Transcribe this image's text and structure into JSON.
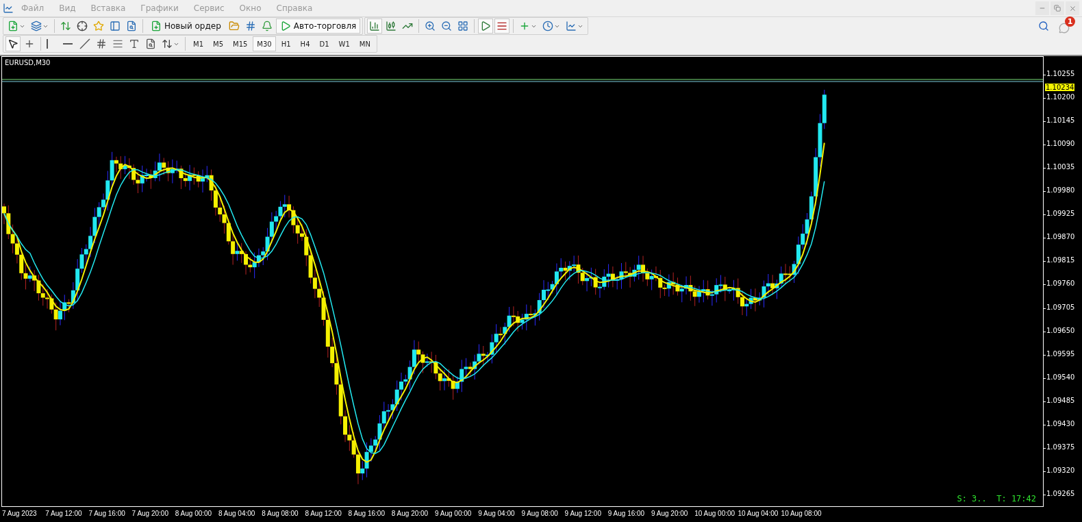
{
  "menu": [
    "Файл",
    "Вид",
    "Вставка",
    "Графики",
    "Сервис",
    "Окно",
    "Справка"
  ],
  "toolbar": {
    "bar_chart": {
      "pressed": true
    },
    "autoscroll": {
      "pressed": true
    },
    "chart_shift": {
      "pressed": true
    },
    "cursor": {
      "pressed": true
    },
    "order_button": {
      "label": "Новый ордер",
      "pressed": false
    },
    "autotrading_button": {
      "label": "Авто-торговля",
      "pressed": true
    },
    "notification_count": "1"
  },
  "timeframes": [
    {
      "label": "M1",
      "selected": false
    },
    {
      "label": "M5",
      "selected": false
    },
    {
      "label": "M15",
      "selected": false
    },
    {
      "label": "M30",
      "selected": true
    },
    {
      "label": "H1",
      "selected": false
    },
    {
      "label": "H4",
      "selected": false
    },
    {
      "label": "D1",
      "selected": false
    },
    {
      "label": "W1",
      "selected": false
    },
    {
      "label": "MN",
      "selected": false
    }
  ],
  "chart": {
    "title": "EURUSD,M30",
    "current_price": "1.10234",
    "price_labels": [
      "1.10255",
      "1.10200",
      "1.10145",
      "1.10090",
      "1.10035",
      "1.09980",
      "1.09925",
      "1.09870",
      "1.09815",
      "1.09760",
      "1.09705",
      "1.09650",
      "1.09595",
      "1.09540",
      "1.09485",
      "1.09430",
      "1.09375",
      "1.09320",
      "1.09265"
    ],
    "time_labels": [
      "7 Aug 2023",
      "7 Aug 12:00",
      "7 Aug 16:00",
      "7 Aug 20:00",
      "8 Aug 00:00",
      "8 Aug 04:00",
      "8 Aug 08:00",
      "8 Aug 12:00",
      "8 Aug 16:00",
      "8 Aug 20:00",
      "9 Aug 00:00",
      "9 Aug 04:00",
      "9 Aug 08:00",
      "9 Aug 12:00",
      "9 Aug 16:00",
      "9 Aug 20:00",
      "10 Aug 00:00",
      "10 Aug 04:00",
      "10 Aug 08:00"
    ],
    "status": "S: 3..  T: 17:42"
  }
}
